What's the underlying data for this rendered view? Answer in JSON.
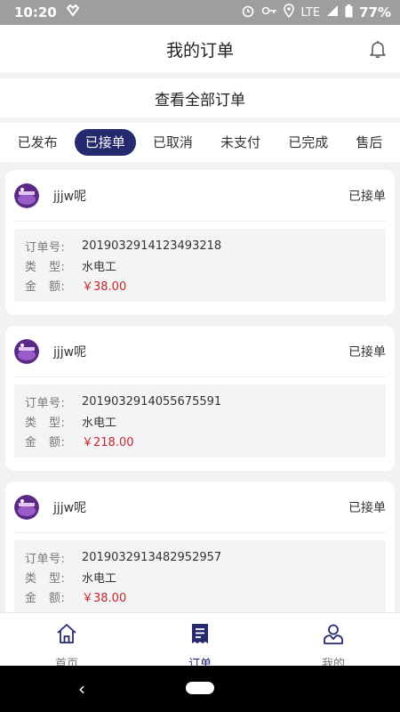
{
  "status_bar": {
    "time": "10:20",
    "network": "LTE",
    "battery": "77%"
  },
  "header": {
    "title": "我的订单"
  },
  "view_all": "查看全部订单",
  "tabs": [
    {
      "label": "已发布"
    },
    {
      "label": "已接单"
    },
    {
      "label": "已取消"
    },
    {
      "label": "未支付"
    },
    {
      "label": "已完成"
    },
    {
      "label": "售后"
    }
  ],
  "active_tab": "已接单",
  "labels": {
    "order_no": "订单号:",
    "type": "类　型:",
    "amount": "金　额:"
  },
  "orders": [
    {
      "user": "jjjw呢",
      "status": "已接单",
      "order_no": "2019032914123493218",
      "type": "水电工",
      "amount": "￥38.00"
    },
    {
      "user": "jjjw呢",
      "status": "已接单",
      "order_no": "2019032914055675591",
      "type": "水电工",
      "amount": "￥218.00"
    },
    {
      "user": "jjjw呢",
      "status": "已接单",
      "order_no": "2019032913482952957",
      "type": "水电工",
      "amount": "￥38.00"
    }
  ],
  "bottom_nav": [
    {
      "label": "首页",
      "icon": "home-icon"
    },
    {
      "label": "订单",
      "icon": "receipt-icon"
    },
    {
      "label": "我的",
      "icon": "user-icon"
    }
  ],
  "active_nav": "订单",
  "colors": {
    "accent": "#252a6e",
    "price": "#c0282d"
  }
}
